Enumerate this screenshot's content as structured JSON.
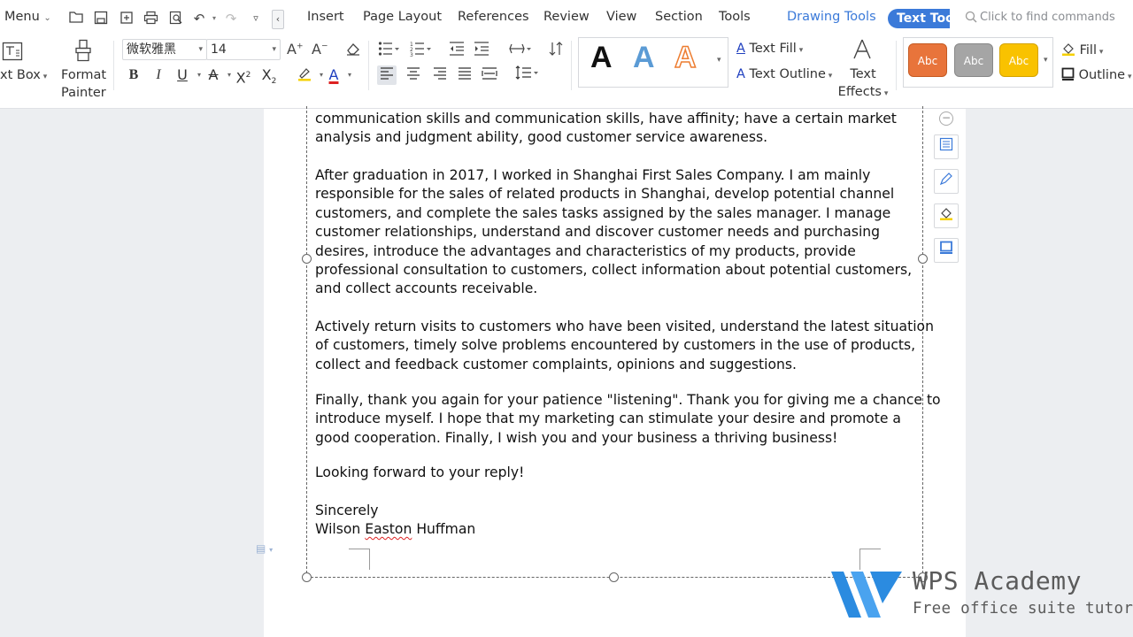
{
  "menubar": {
    "menu_label": "Menu",
    "tabs": [
      "Insert",
      "Page Layout",
      "References",
      "Review",
      "View",
      "Section",
      "Tools"
    ],
    "drawing_tools": "Drawing Tools",
    "text_tools": "Text Tools",
    "find_placeholder": "Click to find commands"
  },
  "ribbon": {
    "text_box": "xt Box",
    "format_painter_line1": "Format",
    "format_painter_line2": "Painter",
    "font_name": "微软雅黑",
    "font_size": "14",
    "text_fill": "Text Fill",
    "text_outline": "Text Outline",
    "text_effects_line1": "Text",
    "text_effects_line2": "Effects",
    "wordart": [
      "A",
      "A",
      "A"
    ],
    "shape_styles": [
      "Abc",
      "Abc",
      "Abc"
    ],
    "fill": "Fill",
    "outline": "Outline",
    "colors": {
      "accent": "#3b7ad9",
      "style_orange": "#e8743b",
      "style_gray": "#a5a5a5",
      "style_yellow": "#f9c200"
    }
  },
  "document": {
    "para1": [
      "communication skills and communication skills, have affinity; have a certain market",
      "analysis and judgment ability, good customer service awareness."
    ],
    "para2": [
      "After graduation in 2017, I worked in Shanghai First Sales Company. I am mainly",
      "responsible for the sales of related products in Shanghai, develop potential channel",
      "customers, and complete the sales tasks assigned by the sales manager. I manage",
      "customer relationships, understand and discover customer needs and purchasing",
      "desires, introduce the advantages and characteristics of my products, provide",
      "professional consultation to customers, collect information about potential customers,",
      "and collect accounts receivable."
    ],
    "para3": [
      "Actively return visits to customers who have been visited, understand the latest situation",
      "of customers, timely solve problems encountered by customers in the use of products,",
      "collect and feedback customer complaints, opinions and suggestions."
    ],
    "para4": [
      "Finally, thank you again for your patience \"listening\". Thank you for giving me a chance to",
      "introduce myself. I hope that my marketing can stimulate your desire and promote a",
      "good cooperation. Finally, I wish you and your business a thriving business!"
    ],
    "closing": "Looking forward to your reply!",
    "sign_off": "Sincerely",
    "name_first": "Wilson",
    "name_middle": "Easton",
    "name_last": "Huffman"
  },
  "watermark": {
    "title": "WPS Academy",
    "subtitle": "Free office suite tutorials"
  }
}
